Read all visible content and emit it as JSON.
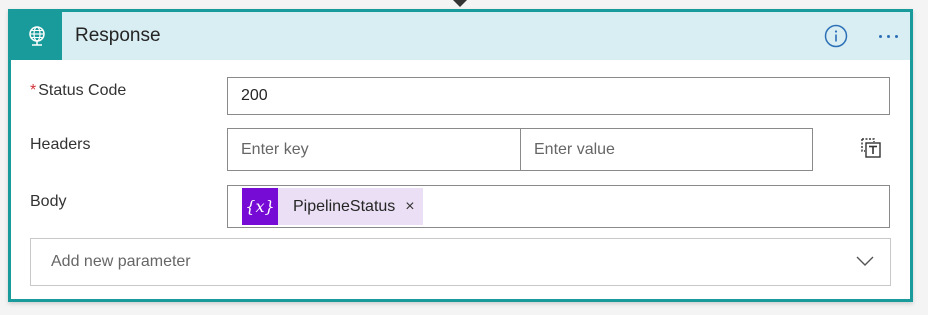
{
  "card": {
    "title": "Response",
    "header_icon": "globe-icon",
    "info_icon": "info-icon",
    "more_icon": "more-options-icon",
    "accent_color": "#1a9b9b",
    "header_bg": "#d8eef2"
  },
  "fields": {
    "status_code": {
      "required_mark": "*",
      "label": "Status Code",
      "value": "200"
    },
    "headers": {
      "label": "Headers",
      "key_placeholder": "Enter key",
      "value_placeholder": "Enter value",
      "switch_icon": "switch-to-text-mode-icon"
    },
    "body": {
      "label": "Body",
      "token": {
        "icon_text": "{x}",
        "label": "PipelineStatus",
        "close": "×",
        "token_color": "#770bd6"
      }
    }
  },
  "add_parameter": {
    "placeholder": "Add new parameter",
    "icon": "chevron-down-icon"
  }
}
